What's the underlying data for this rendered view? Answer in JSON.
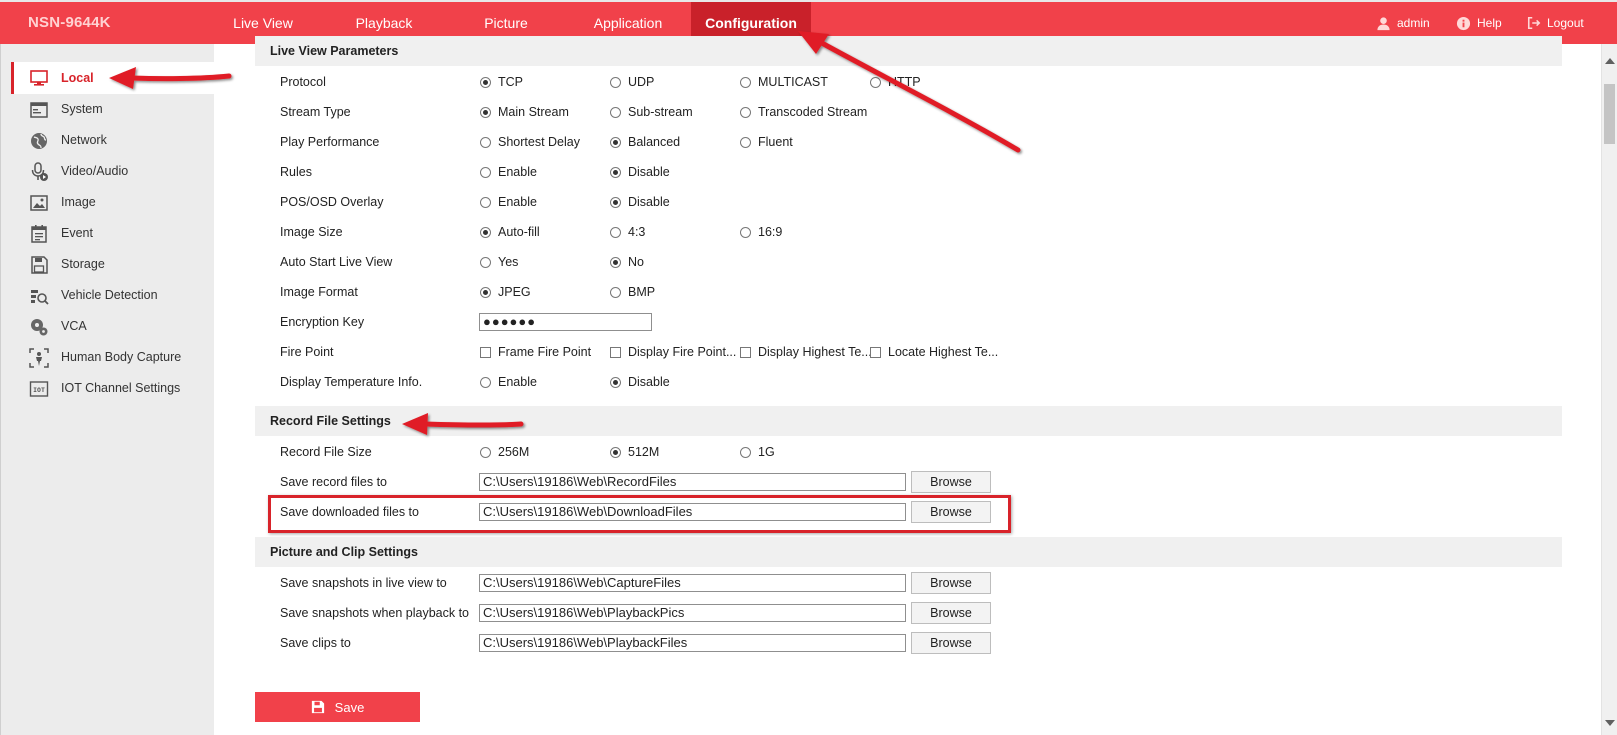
{
  "header": {
    "brand": "NSN-9644K",
    "nav": [
      {
        "label": "Live View"
      },
      {
        "label": "Playback"
      },
      {
        "label": "Picture"
      },
      {
        "label": "Application"
      },
      {
        "label": "Configuration",
        "active": true
      }
    ],
    "user": "admin",
    "help": "Help",
    "logout": "Logout",
    "accent_color": "#f1414a",
    "active_color": "#c9212a"
  },
  "sidebar": {
    "items": [
      {
        "label": "Local",
        "icon": "monitor-icon",
        "active": true
      },
      {
        "label": "System",
        "icon": "system-icon"
      },
      {
        "label": "Network",
        "icon": "globe-icon"
      },
      {
        "label": "Video/Audio",
        "icon": "microphone-icon"
      },
      {
        "label": "Image",
        "icon": "image-icon"
      },
      {
        "label": "Event",
        "icon": "calendar-icon"
      },
      {
        "label": "Storage",
        "icon": "floppy-icon"
      },
      {
        "label": "Vehicle Detection",
        "icon": "vehicle-search-icon"
      },
      {
        "label": "VCA",
        "icon": "vca-gear-icon"
      },
      {
        "label": "Human Body Capture",
        "icon": "body-capture-icon"
      },
      {
        "label": "IOT Channel Settings",
        "icon": "iot-icon"
      }
    ]
  },
  "live_view": {
    "title": "Live View Parameters",
    "protocol": {
      "label": "Protocol",
      "options": [
        "TCP",
        "UDP",
        "MULTICAST",
        "HTTP"
      ],
      "selected": 0
    },
    "stream_type": {
      "label": "Stream Type",
      "options": [
        "Main Stream",
        "Sub-stream",
        "Transcoded Stream"
      ],
      "selected": 0
    },
    "play_performance": {
      "label": "Play Performance",
      "options": [
        "Shortest Delay",
        "Balanced",
        "Fluent"
      ],
      "selected": 1
    },
    "rules": {
      "label": "Rules",
      "options": [
        "Enable",
        "Disable"
      ],
      "selected": 1
    },
    "pos_osd": {
      "label": "POS/OSD Overlay",
      "options": [
        "Enable",
        "Disable"
      ],
      "selected": 1
    },
    "image_size": {
      "label": "Image Size",
      "options": [
        "Auto-fill",
        "4:3",
        "16:9"
      ],
      "selected": 0
    },
    "auto_start": {
      "label": "Auto Start Live View",
      "options": [
        "Yes",
        "No"
      ],
      "selected": 1
    },
    "image_format": {
      "label": "Image Format",
      "options": [
        "JPEG",
        "BMP"
      ],
      "selected": 0
    },
    "encryption_key": {
      "label": "Encryption Key",
      "value": "●●●●●●"
    },
    "fire_point": {
      "label": "Fire Point",
      "options": [
        "Frame Fire Point",
        "Display Fire Point...",
        "Display Highest Te...",
        "Locate Highest Te..."
      ]
    },
    "display_temp": {
      "label": "Display Temperature Info.",
      "options": [
        "Enable",
        "Disable"
      ],
      "selected": 1
    }
  },
  "record": {
    "title": "Record File Settings",
    "file_size": {
      "label": "Record File Size",
      "options": [
        "256M",
        "512M",
        "1G"
      ],
      "selected": 1
    },
    "save_record": {
      "label": "Save record files to",
      "value": "C:\\Users\\19186\\Web\\RecordFiles",
      "button": "Browse"
    },
    "save_downloaded": {
      "label": "Save downloaded files to",
      "value": "C:\\Users\\19186\\Web\\DownloadFiles",
      "button": "Browse"
    }
  },
  "picture_clip": {
    "title": "Picture and Clip Settings",
    "snap_live": {
      "label": "Save snapshots in live view to",
      "value": "C:\\Users\\19186\\Web\\CaptureFiles",
      "button": "Browse"
    },
    "snap_playback": {
      "label": "Save snapshots when playback to",
      "value": "C:\\Users\\19186\\Web\\PlaybackPics",
      "button": "Browse"
    },
    "clips": {
      "label": "Save clips to",
      "value": "C:\\Users\\19186\\Web\\PlaybackFiles",
      "button": "Browse"
    }
  },
  "save_label": "Save"
}
